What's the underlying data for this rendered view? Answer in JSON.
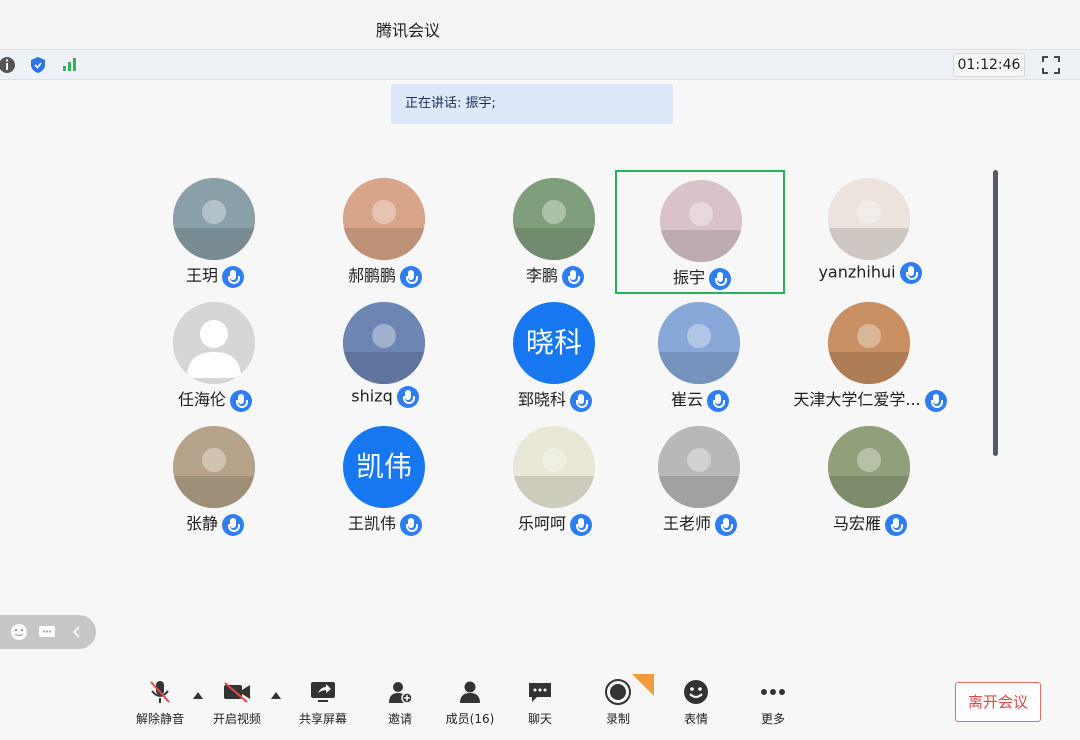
{
  "window": {
    "title": "腾讯会议"
  },
  "status": {
    "timer": "01:12:46",
    "icons": [
      "info-icon",
      "shield-icon",
      "signal-icon",
      "fullscreen-icon"
    ]
  },
  "speaker": {
    "text": "正在讲话: 振宇;"
  },
  "participants": [
    {
      "name": "王玥",
      "avatar": "photo",
      "color": "#8aa0a8"
    },
    {
      "name": "郝鹏鹏",
      "avatar": "photo",
      "color": "#d9a58a"
    },
    {
      "name": "李鹏",
      "avatar": "photo",
      "color": "#7f9e7c"
    },
    {
      "name": "振宇",
      "avatar": "photo",
      "color": "#d9c3c8",
      "speaking": true
    },
    {
      "name": "yanzhihui",
      "avatar": "photo",
      "color": "#ece3dc"
    },
    {
      "name": "任海伦",
      "avatar": "default",
      "color": "#d6d6d6"
    },
    {
      "name": "shizq",
      "avatar": "photo",
      "color": "#6d86b3"
    },
    {
      "name": "郅晓科",
      "avatar": "text",
      "text": "晓科",
      "color": "#1677f0"
    },
    {
      "name": "崔云",
      "avatar": "photo",
      "color": "#87a8d8"
    },
    {
      "name": "天津大学仁爱学...",
      "avatar": "photo",
      "color": "#c78f62"
    },
    {
      "name": "张静",
      "avatar": "photo",
      "color": "#b7a389"
    },
    {
      "name": "王凯伟",
      "avatar": "text",
      "text": "凯伟",
      "color": "#1677f0"
    },
    {
      "name": "乐呵呵",
      "avatar": "photo",
      "color": "#e9e7d6"
    },
    {
      "name": "王老师",
      "avatar": "photo",
      "color": "#b8b8b8"
    },
    {
      "name": "马宏雁",
      "avatar": "photo",
      "color": "#8fa07a"
    }
  ],
  "toolbar": {
    "unmute": "解除静音",
    "video": "开启视频",
    "share": "共享屏幕",
    "invite": "邀请",
    "members": "成员(16)",
    "chat": "聊天",
    "record": "录制",
    "reaction": "表情",
    "more": "更多",
    "leave": "离开会议"
  },
  "colors": {
    "accent": "#2e7df3",
    "speaking_border": "#26b15c",
    "leave": "#e04848"
  }
}
